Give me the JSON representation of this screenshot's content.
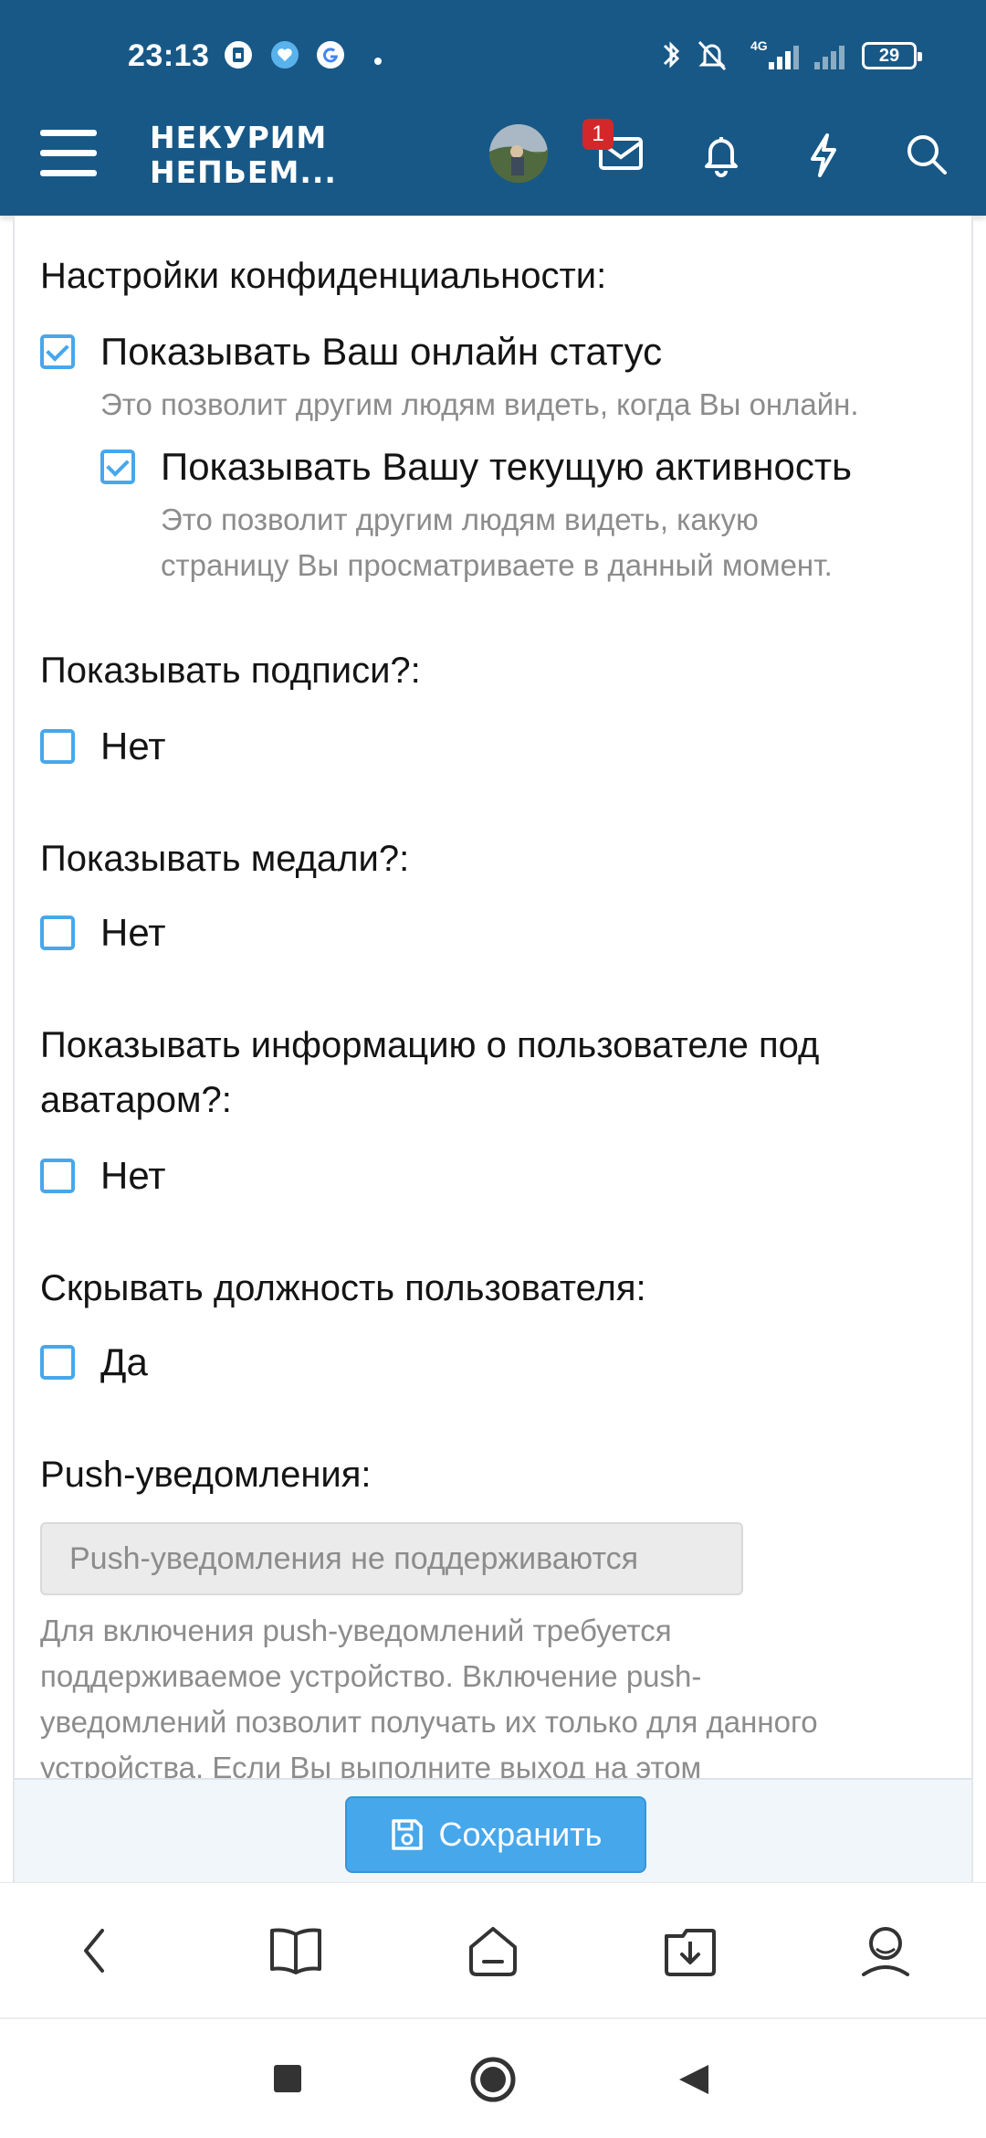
{
  "status_bar": {
    "time": "23:13",
    "network": "4G",
    "battery": "29"
  },
  "header": {
    "logo_line1": "НЕКУРИМ",
    "logo_line2": "НЕПЬЕМ...",
    "messages_badge": "1"
  },
  "privacy": {
    "title": "Настройки конфиденциальности:",
    "online_status_label": "Показывать Ваш онлайн статус",
    "online_status_checked": true,
    "online_status_hint": "Это позволит другим людям видеть, когда Вы онлайн.",
    "activity_label": "Показывать Вашу текущую активность",
    "activity_checked": true,
    "activity_hint_line1": "Это позволит другим людям видеть, какую",
    "activity_hint_line2": "страницу Вы просматриваете в данный момент."
  },
  "signatures": {
    "title": "Показывать подписи?:",
    "option": "Нет",
    "checked": false
  },
  "medals": {
    "title": "Показывать медали?:",
    "option": "Нет",
    "checked": false
  },
  "user_info": {
    "title_line1": "Показывать информацию о пользователе под",
    "title_line2": "аватаром?:",
    "option": "Нет",
    "checked": false
  },
  "hide_title": {
    "title": "Скрывать должность пользователя:",
    "option": "Да",
    "checked": false
  },
  "push": {
    "title": "Push-уведомления:",
    "button": "Push-уведомления не поддерживаются",
    "hint_line1": "Для включения push-уведомлений требуется",
    "hint_line2": "поддерживаемое устройство. Включение push-",
    "hint_line3": "уведомлений позволит получать их только для данного",
    "hint_line4": "устройства. Если Вы выполните выход на этом"
  },
  "save_button": "Сохранить",
  "colors": {
    "header_bg": "#185886",
    "accent": "#47a7eb",
    "badge": "#d4272a",
    "hint_text": "#8c8c8c"
  },
  "icons": {
    "header": [
      "menu-icon",
      "avatar",
      "mail-icon",
      "bell-icon",
      "lightning-icon",
      "search-icon"
    ],
    "browser_bar": [
      "back-icon",
      "book-icon",
      "home-icon",
      "download-icon",
      "profile-icon"
    ],
    "system_nav": [
      "recents-icon",
      "home-circle-icon",
      "back-triangle-icon"
    ]
  }
}
